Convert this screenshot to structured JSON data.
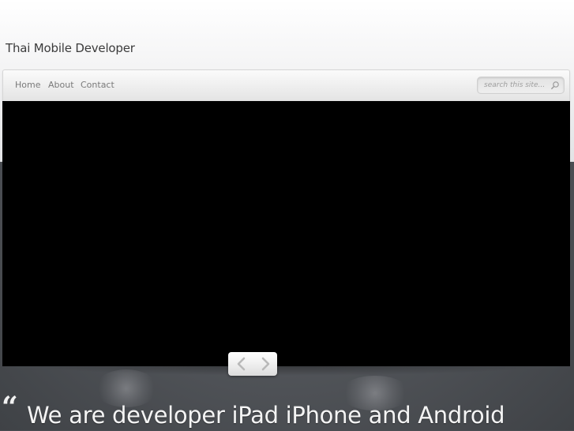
{
  "site": {
    "title": "Thai Mobile Developer"
  },
  "nav": {
    "items": [
      {
        "label": "Home"
      },
      {
        "label": "About"
      },
      {
        "label": "Contact"
      }
    ]
  },
  "search": {
    "placeholder": "search this site..."
  },
  "slider": {
    "prev_icon": "chevron-left-icon",
    "next_icon": "chevron-right-icon"
  },
  "tagline": {
    "quote_mark": "“",
    "text": "We are developer iPad iPhone and Android"
  },
  "colors": {
    "slider_background": "#000000",
    "page_top": "#f3f3f4",
    "page_bottom": "#4a4d52",
    "tagline_text": "#f4f4f4"
  }
}
